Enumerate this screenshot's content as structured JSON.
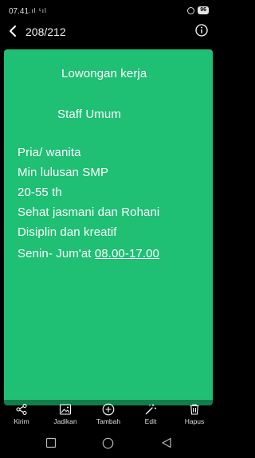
{
  "status_bar": {
    "time": "07.41",
    "signals": ".ıl ⁵ıl",
    "battery": "96"
  },
  "header": {
    "counter": "208/212"
  },
  "poster": {
    "heading": "Lowongan kerja",
    "position": "Staff Umum",
    "requirements": [
      "Pria/ wanita",
      "Min lulusan SMP",
      "20-55 th",
      "Sehat jasmani dan Rohani",
      "Disiplin dan kreatif"
    ],
    "schedule_days": "Senin- Jum'at ",
    "schedule_hours": "08.00-17.00"
  },
  "toolbar": {
    "share_label": "Kirim",
    "set_as_label": "Jadikan",
    "add_label": "Tambah",
    "edit_label": "Edit",
    "delete_label": "Hapus"
  },
  "colors": {
    "poster_background": "#1fbf74"
  }
}
